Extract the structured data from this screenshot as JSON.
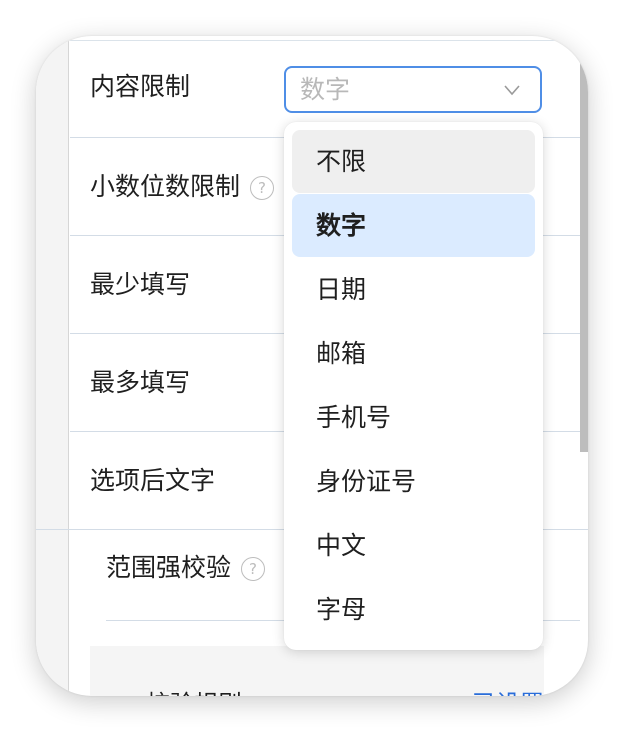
{
  "form": {
    "rows": [
      {
        "label": "内容限制"
      },
      {
        "label": "小数位数限制",
        "help": "?"
      },
      {
        "label": "最少填写"
      },
      {
        "label": "最多填写"
      },
      {
        "label": "选项后文字"
      }
    ],
    "range_check": {
      "label": "范围强校验",
      "help": "?"
    },
    "rule_panel": {
      "label": "校验规则",
      "value": "已设置"
    }
  },
  "select": {
    "value": "数字",
    "icon": "chevron-down-icon"
  },
  "dropdown": {
    "options": [
      "不限",
      "数字",
      "日期",
      "邮箱",
      "手机号",
      "身份证号",
      "中文",
      "字母"
    ],
    "hovered": "不限",
    "selected": "数字"
  },
  "colors": {
    "accent": "#4f8ee6",
    "selected_bg": "#dbebff",
    "link": "#2a6dd9"
  }
}
